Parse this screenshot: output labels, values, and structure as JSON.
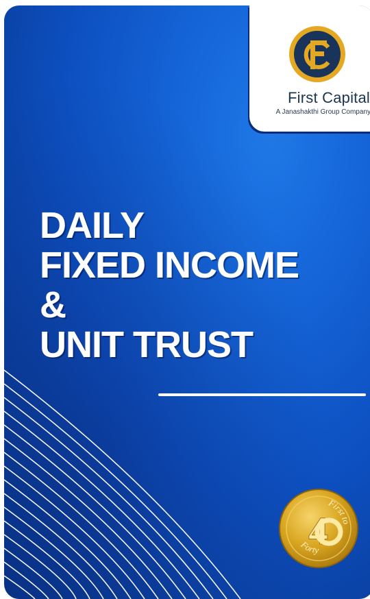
{
  "brand": {
    "name": "First Capital",
    "tagline": "A Janashakthi Group Company",
    "emblem_text": "FC",
    "accent_color": "#e5a823",
    "navy_color": "#18345a"
  },
  "headline": {
    "line1": "DAILY",
    "line2": "FIXED INCOME",
    "line3": "&",
    "line4": "UNIT TRUST"
  },
  "badge": {
    "number": "40",
    "text_top": "First to",
    "text_bottom": "Forty",
    "color": "#d9a520"
  },
  "colors": {
    "background_primary": "#1565d8",
    "background_dark": "#08358a",
    "headline": "#ffffff"
  }
}
